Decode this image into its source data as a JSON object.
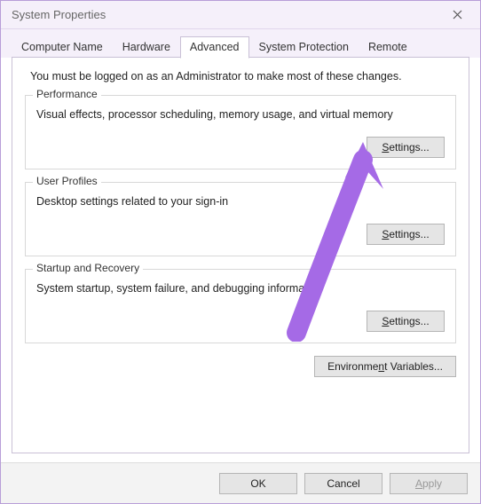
{
  "window": {
    "title": "System Properties"
  },
  "tabs": {
    "computer_name": "Computer Name",
    "hardware": "Hardware",
    "advanced": "Advanced",
    "system_protection": "System Protection",
    "remote": "Remote"
  },
  "intro_text": "You must be logged on as an Administrator to make most of these changes.",
  "groups": {
    "performance": {
      "legend": "Performance",
      "desc": "Visual effects, processor scheduling, memory usage, and virtual memory",
      "button_prefix": "S",
      "button_rest": "ettings..."
    },
    "user_profiles": {
      "legend": "User Profiles",
      "desc": "Desktop settings related to your sign-in",
      "button_prefix": "S",
      "button_rest": "ettings..."
    },
    "startup_recovery": {
      "legend": "Startup and Recovery",
      "desc": "System startup, system failure, and debugging information",
      "button_prefix": "S",
      "button_rest": "ettings..."
    }
  },
  "env_button": {
    "prefix": "Environme",
    "u": "n",
    "rest": "t Variables..."
  },
  "footer": {
    "ok": "OK",
    "cancel": "Cancel",
    "apply_u": "A",
    "apply_rest": "pply"
  }
}
